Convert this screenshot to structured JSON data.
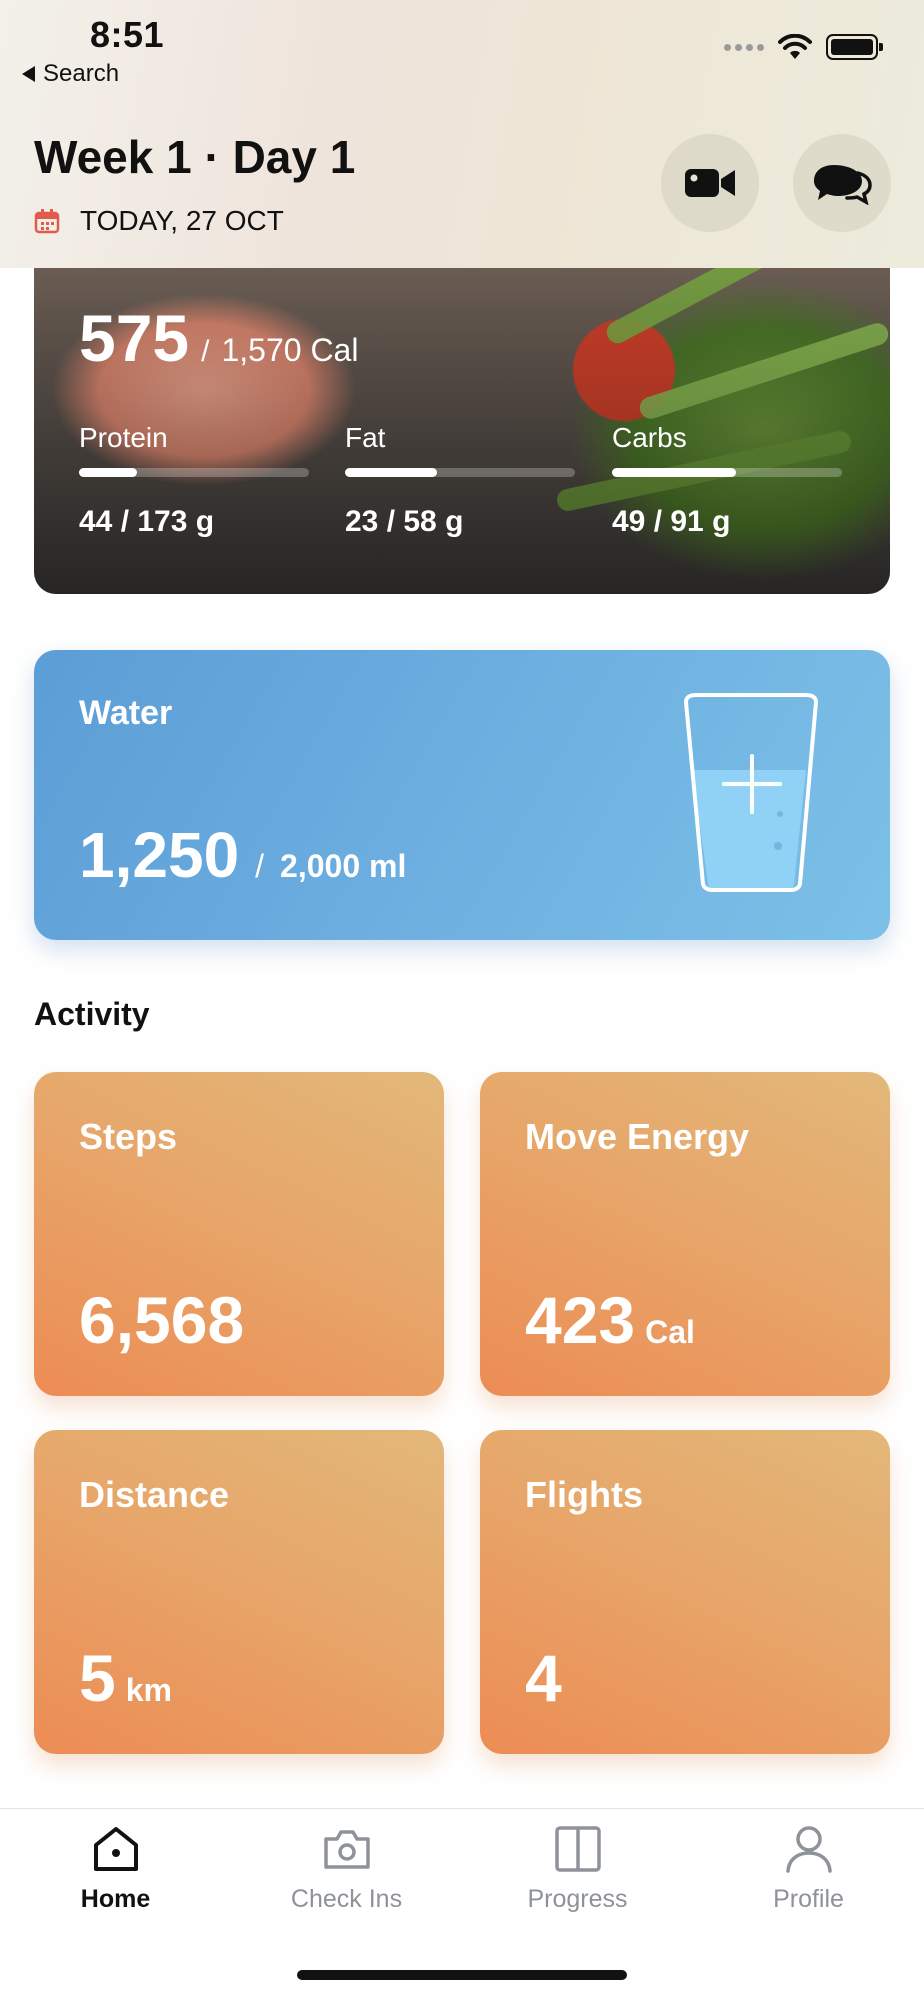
{
  "status_bar": {
    "time": "8:51",
    "back_label": "Search"
  },
  "header": {
    "title": "Week 1 · Day 1",
    "date": "TODAY, 27 OCT",
    "icons": [
      "calendar-icon",
      "video-camera-icon",
      "chat-bubbles-icon"
    ]
  },
  "nutrition": {
    "calories_value": "575",
    "calories_total": "1,570 Cal",
    "macros": [
      {
        "name": "Protein",
        "value": "44 / 173 g",
        "progress": 0.25
      },
      {
        "name": "Fat",
        "value": "23 / 58 g",
        "progress": 0.4
      },
      {
        "name": "Carbs",
        "value": "49 / 91 g",
        "progress": 0.54
      }
    ]
  },
  "water": {
    "title": "Water",
    "value": "1,250",
    "total": "2,000 ml"
  },
  "activity": {
    "title": "Activity",
    "tiles": [
      {
        "label": "Steps",
        "value": "6,568",
        "unit": ""
      },
      {
        "label": "Move Energy",
        "value": "423",
        "unit": "Cal"
      },
      {
        "label": "Distance",
        "value": "5",
        "unit": "km"
      },
      {
        "label": "Flights",
        "value": "4",
        "unit": ""
      }
    ]
  },
  "tabbar": {
    "tabs": [
      {
        "label": "Home",
        "icon": "home-icon",
        "active": true
      },
      {
        "label": "Check Ins",
        "icon": "camera-icon",
        "active": false
      },
      {
        "label": "Progress",
        "icon": "progress-icon",
        "active": false
      },
      {
        "label": "Profile",
        "icon": "profile-icon",
        "active": false
      }
    ]
  },
  "colors": {
    "water_gradient_start": "#5c9dd6",
    "water_gradient_end": "#7cc1e8",
    "activity_gradient_start": "#ec8c54",
    "activity_gradient_end": "#e2b87a",
    "calendar_icon": "#e25b4a"
  }
}
